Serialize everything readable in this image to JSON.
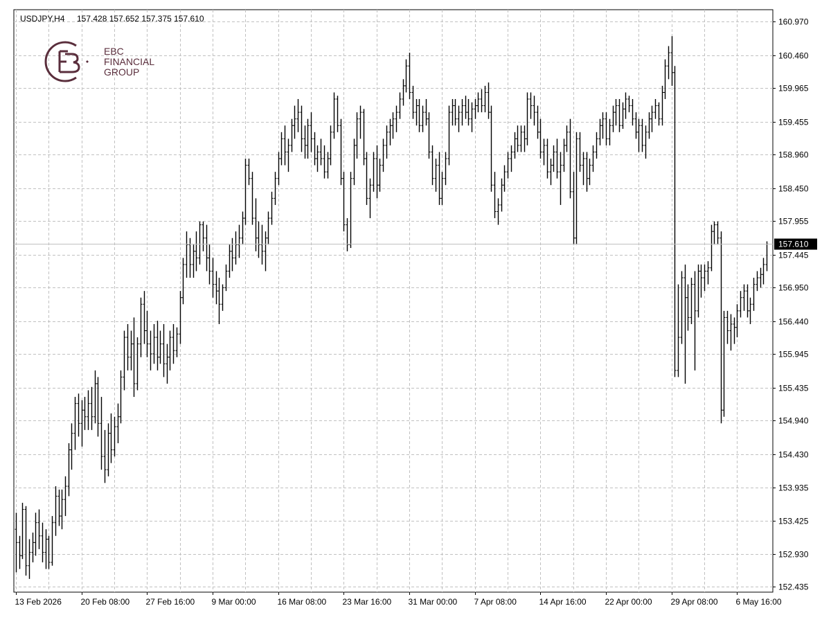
{
  "header": {
    "symbol": "USDJPY,H4",
    "ohlc": "157.428 157.652 157.375 157.610"
  },
  "logo": {
    "line1": "EBC",
    "line2": "FINANCIAL",
    "line3": "GROUP",
    "color": "#5a2e3c"
  },
  "colors": {
    "bars": "#000000",
    "grid": "#c0c0c0",
    "axis": "#000000",
    "current_price_line": "#c0c0c0",
    "current_price_label_bg": "#000000",
    "current_price_label_text": "#ffffff"
  },
  "chart_data": {
    "type": "ohlc",
    "timeframe": "H4",
    "y_ticks": [
      160.97,
      160.46,
      159.965,
      159.455,
      158.96,
      158.45,
      157.955,
      157.445,
      156.95,
      156.44,
      155.945,
      155.435,
      154.94,
      154.43,
      153.935,
      153.425,
      152.93,
      152.435
    ],
    "y_tick_labels": [
      "160.970",
      "160.460",
      "159.965",
      "159.455",
      "158.960",
      "158.450",
      "157.955",
      "157.445",
      "156.950",
      "156.440",
      "155.945",
      "155.435",
      "154.940",
      "154.430",
      "153.935",
      "153.425",
      "152.930",
      "152.435"
    ],
    "ylim": [
      152.35,
      161.15
    ],
    "x_tick_labels": [
      "13 Feb 2026",
      "20 Feb 08:00",
      "27 Feb 16:00",
      "9 Mar 00:00",
      "16 Mar 08:00",
      "23 Mar 16:00",
      "31 Mar 00:00",
      "7 Apr 08:00",
      "14 Apr 16:00",
      "22 Apr 00:00",
      "29 Apr 08:00",
      "6 May 16:00"
    ],
    "x_tick_bar_index": [
      0,
      20,
      40,
      60,
      80,
      100,
      120,
      140,
      160,
      180,
      200,
      220
    ],
    "current_price": 157.61,
    "current_price_label": "157.610",
    "grid": true,
    "bars": [
      [
        153.3,
        153.55,
        152.65,
        153.1
      ],
      [
        153.1,
        153.2,
        152.7,
        152.9
      ],
      [
        152.9,
        153.7,
        152.85,
        153.6
      ],
      [
        153.6,
        153.65,
        152.6,
        152.75
      ],
      [
        152.75,
        153.15,
        152.55,
        152.95
      ],
      [
        152.95,
        153.25,
        152.8,
        153.1
      ],
      [
        153.1,
        153.55,
        152.9,
        153.4
      ],
      [
        153.4,
        153.6,
        153.0,
        153.2
      ],
      [
        153.2,
        153.4,
        152.8,
        152.95
      ],
      [
        152.95,
        153.3,
        152.7,
        153.15
      ],
      [
        153.15,
        153.2,
        152.7,
        152.8
      ],
      [
        152.8,
        153.5,
        152.75,
        153.4
      ],
      [
        153.4,
        153.95,
        153.2,
        153.8
      ],
      [
        153.8,
        153.9,
        153.35,
        153.5
      ],
      [
        153.5,
        153.9,
        153.3,
        153.75
      ],
      [
        153.75,
        154.1,
        153.5,
        153.95
      ],
      [
        153.95,
        154.6,
        153.8,
        154.5
      ],
      [
        154.5,
        154.9,
        154.2,
        154.75
      ],
      [
        154.75,
        155.3,
        154.5,
        155.2
      ],
      [
        155.2,
        155.35,
        154.7,
        154.9
      ],
      [
        154.9,
        155.25,
        154.55,
        155.1
      ],
      [
        155.1,
        155.3,
        154.8,
        155.0
      ],
      [
        155.0,
        155.4,
        154.8,
        155.2
      ],
      [
        155.2,
        155.45,
        154.8,
        155.0
      ],
      [
        155.0,
        155.7,
        154.9,
        155.5
      ],
      [
        155.5,
        155.6,
        154.7,
        154.9
      ],
      [
        154.9,
        155.3,
        154.2,
        154.4
      ],
      [
        154.4,
        154.8,
        154.0,
        154.2
      ],
      [
        154.2,
        154.9,
        154.1,
        154.75
      ],
      [
        154.75,
        155.05,
        154.3,
        154.5
      ],
      [
        154.5,
        155.0,
        154.4,
        154.85
      ],
      [
        154.85,
        155.2,
        154.6,
        155.0
      ],
      [
        155.0,
        155.7,
        154.9,
        155.6
      ],
      [
        155.6,
        156.3,
        155.4,
        156.2
      ],
      [
        156.2,
        156.4,
        155.7,
        155.9
      ],
      [
        155.9,
        156.3,
        155.7,
        156.1
      ],
      [
        156.1,
        156.5,
        155.3,
        155.5
      ],
      [
        155.5,
        156.2,
        155.4,
        156.1
      ],
      [
        156.1,
        156.8,
        155.9,
        156.7
      ],
      [
        156.7,
        156.9,
        156.1,
        156.3
      ],
      [
        156.3,
        156.6,
        155.9,
        156.1
      ],
      [
        156.1,
        156.3,
        155.7,
        155.95
      ],
      [
        155.95,
        156.4,
        155.8,
        156.2
      ],
      [
        156.2,
        156.45,
        155.7,
        155.9
      ],
      [
        155.9,
        156.3,
        155.8,
        156.1
      ],
      [
        156.1,
        156.4,
        155.6,
        155.8
      ],
      [
        155.8,
        156.1,
        155.5,
        155.9
      ],
      [
        155.9,
        156.3,
        155.7,
        156.2
      ],
      [
        156.2,
        156.4,
        155.8,
        156.0
      ],
      [
        156.0,
        156.35,
        155.9,
        156.25
      ],
      [
        156.25,
        156.9,
        156.1,
        156.8
      ],
      [
        156.8,
        157.4,
        156.7,
        157.3
      ],
      [
        157.3,
        157.8,
        157.1,
        157.6
      ],
      [
        157.6,
        157.7,
        157.1,
        157.3
      ],
      [
        157.3,
        157.6,
        157.1,
        157.5
      ],
      [
        157.5,
        157.8,
        157.2,
        157.4
      ],
      [
        157.4,
        157.95,
        157.3,
        157.9
      ],
      [
        157.9,
        157.95,
        157.5,
        157.7
      ],
      [
        157.7,
        157.9,
        157.2,
        157.4
      ],
      [
        157.4,
        157.6,
        157.0,
        157.2
      ],
      [
        157.2,
        157.4,
        156.8,
        157.0
      ],
      [
        157.0,
        157.2,
        156.7,
        156.9
      ],
      [
        156.9,
        157.1,
        156.4,
        156.7
      ],
      [
        156.7,
        157.0,
        156.6,
        156.95
      ],
      [
        156.95,
        157.3,
        156.9,
        157.2
      ],
      [
        157.2,
        157.6,
        157.1,
        157.5
      ],
      [
        157.5,
        157.7,
        157.2,
        157.4
      ],
      [
        157.4,
        157.8,
        157.3,
        157.6
      ],
      [
        157.6,
        157.9,
        157.4,
        157.7
      ],
      [
        157.7,
        158.1,
        157.6,
        158.0
      ],
      [
        158.0,
        158.9,
        157.9,
        158.8
      ],
      [
        158.8,
        158.9,
        158.5,
        158.6
      ],
      [
        158.6,
        158.7,
        157.9,
        158.0
      ],
      [
        158.0,
        158.3,
        157.5,
        157.7
      ],
      [
        157.7,
        157.95,
        157.4,
        157.6
      ],
      [
        157.6,
        157.9,
        157.3,
        157.5
      ],
      [
        157.5,
        157.8,
        157.2,
        157.7
      ],
      [
        157.7,
        158.1,
        157.6,
        158.0
      ],
      [
        158.0,
        158.4,
        157.9,
        158.3
      ],
      [
        158.3,
        158.7,
        158.2,
        158.6
      ],
      [
        158.6,
        159.0,
        158.5,
        158.9
      ],
      [
        158.9,
        159.3,
        158.8,
        159.2
      ],
      [
        159.2,
        159.4,
        158.8,
        159.0
      ],
      [
        159.0,
        159.2,
        158.7,
        159.1
      ],
      [
        159.1,
        159.5,
        159.0,
        159.4
      ],
      [
        159.4,
        159.7,
        159.2,
        159.5
      ],
      [
        159.5,
        159.8,
        159.3,
        159.6
      ],
      [
        159.6,
        159.7,
        159.0,
        159.2
      ],
      [
        159.2,
        159.4,
        158.9,
        159.1
      ],
      [
        159.1,
        159.5,
        158.9,
        159.4
      ],
      [
        159.4,
        159.6,
        159.0,
        159.2
      ],
      [
        159.2,
        159.3,
        158.8,
        158.9
      ],
      [
        158.9,
        159.1,
        158.7,
        159.0
      ],
      [
        159.0,
        159.2,
        158.8,
        158.9
      ],
      [
        158.9,
        159.1,
        158.6,
        158.7
      ],
      [
        158.7,
        159.0,
        158.6,
        158.9
      ],
      [
        158.9,
        159.4,
        158.8,
        159.3
      ],
      [
        159.3,
        159.9,
        159.2,
        159.8
      ],
      [
        159.8,
        159.85,
        159.3,
        159.4
      ],
      [
        159.4,
        159.5,
        158.5,
        158.6
      ],
      [
        158.6,
        158.7,
        157.8,
        157.9
      ],
      [
        157.9,
        158.0,
        157.5,
        157.6
      ],
      [
        157.6,
        158.7,
        157.55,
        158.6
      ],
      [
        158.6,
        159.2,
        158.5,
        159.1
      ],
      [
        159.1,
        159.6,
        158.9,
        159.5
      ],
      [
        159.5,
        159.7,
        159.2,
        159.6
      ],
      [
        159.6,
        159.65,
        158.8,
        158.9
      ],
      [
        158.9,
        159.0,
        158.2,
        158.3
      ],
      [
        158.3,
        158.6,
        158.0,
        158.5
      ],
      [
        158.5,
        159.0,
        158.4,
        158.9
      ],
      [
        158.9,
        159.1,
        158.3,
        158.5
      ],
      [
        158.5,
        158.9,
        158.4,
        158.8
      ],
      [
        158.8,
        159.2,
        158.7,
        159.1
      ],
      [
        159.1,
        159.4,
        158.9,
        159.3
      ],
      [
        159.3,
        159.5,
        159.1,
        159.4
      ],
      [
        159.4,
        159.6,
        159.2,
        159.5
      ],
      [
        159.5,
        159.7,
        159.3,
        159.6
      ],
      [
        159.6,
        159.9,
        159.5,
        159.8
      ],
      [
        159.8,
        160.1,
        159.7,
        160.0
      ],
      [
        160.0,
        160.4,
        159.9,
        160.3
      ],
      [
        160.3,
        160.5,
        159.8,
        159.9
      ],
      [
        159.9,
        160.0,
        159.5,
        159.6
      ],
      [
        159.6,
        159.8,
        159.4,
        159.7
      ],
      [
        159.7,
        159.8,
        159.3,
        159.4
      ],
      [
        159.4,
        159.7,
        159.3,
        159.6
      ],
      [
        159.6,
        159.8,
        159.4,
        159.5
      ],
      [
        159.5,
        159.6,
        158.9,
        159.0
      ],
      [
        159.0,
        159.1,
        158.5,
        158.6
      ],
      [
        158.6,
        158.9,
        158.4,
        158.8
      ],
      [
        158.8,
        159.0,
        158.2,
        158.3
      ],
      [
        158.3,
        158.7,
        158.2,
        158.6
      ],
      [
        158.6,
        159.0,
        158.5,
        158.9
      ],
      [
        158.9,
        159.7,
        158.8,
        159.6
      ],
      [
        159.6,
        159.8,
        159.4,
        159.7
      ],
      [
        159.7,
        159.8,
        159.4,
        159.5
      ],
      [
        159.5,
        159.7,
        159.3,
        159.6
      ],
      [
        159.6,
        159.8,
        159.4,
        159.7
      ],
      [
        159.7,
        159.85,
        159.5,
        159.6
      ],
      [
        159.6,
        159.8,
        159.4,
        159.5
      ],
      [
        159.5,
        159.75,
        159.3,
        159.65
      ],
      [
        159.65,
        159.8,
        159.5,
        159.7
      ],
      [
        159.7,
        159.9,
        159.6,
        159.8
      ],
      [
        159.8,
        159.95,
        159.6,
        159.7
      ],
      [
        159.7,
        160.0,
        159.6,
        159.9
      ],
      [
        159.9,
        160.05,
        159.5,
        159.6
      ]
    ],
    "bars_part2": [
      [
        159.6,
        159.7,
        158.4,
        158.5
      ],
      [
        158.5,
        158.7,
        158.0,
        158.1
      ],
      [
        158.1,
        158.3,
        157.9,
        158.2
      ],
      [
        158.2,
        158.6,
        158.1,
        158.5
      ],
      [
        158.5,
        158.8,
        158.4,
        158.7
      ],
      [
        158.7,
        159.0,
        158.6,
        158.9
      ],
      [
        158.9,
        159.1,
        158.7,
        159.0
      ],
      [
        159.0,
        159.3,
        158.9,
        159.2
      ],
      [
        159.2,
        159.4,
        159.0,
        159.1
      ],
      [
        159.1,
        159.4,
        159.0,
        159.3
      ],
      [
        159.3,
        159.4,
        159.0,
        159.2
      ],
      [
        159.2,
        159.9,
        159.1,
        159.8
      ],
      [
        159.8,
        159.9,
        159.5,
        159.7
      ],
      [
        159.7,
        159.85,
        159.4,
        159.6
      ],
      [
        159.6,
        159.7,
        159.2,
        159.3
      ],
      [
        159.3,
        159.5,
        158.9,
        159.0
      ],
      [
        159.0,
        159.2,
        158.8,
        159.1
      ],
      [
        159.1,
        159.2,
        158.6,
        158.7
      ],
      [
        158.7,
        158.9,
        158.5,
        158.8
      ],
      [
        158.8,
        159.1,
        158.7,
        159.0
      ],
      [
        159.0,
        159.2,
        158.6,
        158.7
      ],
      [
        158.7,
        159.0,
        158.2,
        158.8
      ],
      [
        158.8,
        159.2,
        158.7,
        159.1
      ],
      [
        159.1,
        159.4,
        159.0,
        159.3
      ],
      [
        159.3,
        159.5,
        158.3,
        158.4
      ],
      [
        158.4,
        158.7,
        157.6,
        157.7
      ],
      [
        157.7,
        159.3,
        157.6,
        159.2
      ],
      [
        159.2,
        159.3,
        158.7,
        158.8
      ],
      [
        158.8,
        159.0,
        158.5,
        158.9
      ],
      [
        158.9,
        159.0,
        158.4,
        158.6
      ],
      [
        158.6,
        158.9,
        158.5,
        158.8
      ],
      [
        158.8,
        159.1,
        158.7,
        159.0
      ],
      [
        159.0,
        159.3,
        158.9,
        159.2
      ],
      [
        159.2,
        159.5,
        159.1,
        159.4
      ],
      [
        159.4,
        159.6,
        159.2,
        159.5
      ],
      [
        159.5,
        159.6,
        159.1,
        159.2
      ],
      [
        159.2,
        159.5,
        159.1,
        159.4
      ],
      [
        159.4,
        159.7,
        159.3,
        159.6
      ],
      [
        159.6,
        159.8,
        159.4,
        159.7
      ],
      [
        159.7,
        159.8,
        159.3,
        159.4
      ],
      [
        159.4,
        159.75,
        159.35,
        159.65
      ],
      [
        159.65,
        159.9,
        159.5,
        159.8
      ],
      [
        159.8,
        159.85,
        159.6,
        159.7
      ],
      [
        159.7,
        159.8,
        159.4,
        159.5
      ],
      [
        159.5,
        159.6,
        159.2,
        159.3
      ],
      [
        159.3,
        159.5,
        159.0,
        159.4
      ],
      [
        159.4,
        159.5,
        159.0,
        159.1
      ],
      [
        159.1,
        159.4,
        158.9,
        159.3
      ],
      [
        159.3,
        159.6,
        159.2,
        159.5
      ],
      [
        159.5,
        159.7,
        159.3,
        159.6
      ],
      [
        159.6,
        159.8,
        159.5,
        159.7
      ],
      [
        159.7,
        159.75,
        159.4,
        159.5
      ],
      [
        159.5,
        160.0,
        159.4,
        159.9
      ],
      [
        159.9,
        160.4,
        159.8,
        160.3
      ],
      [
        160.3,
        160.6,
        160.1,
        160.5
      ],
      [
        160.5,
        160.75,
        160.0,
        160.2
      ],
      [
        160.2,
        160.3,
        155.6,
        155.7
      ],
      [
        155.7,
        157.0,
        155.6,
        156.2
      ],
      [
        156.2,
        157.2,
        156.1,
        157.1
      ],
      [
        157.1,
        157.3,
        155.5,
        156.8
      ],
      [
        156.8,
        157.0,
        156.3,
        156.5
      ],
      [
        156.5,
        157.1,
        156.4,
        157.0
      ],
      [
        157.0,
        157.2,
        155.7,
        156.6
      ],
      [
        156.6,
        157.3,
        156.5,
        157.2
      ],
      [
        157.2,
        157.3,
        156.8,
        157.1
      ],
      [
        157.1,
        157.3,
        156.9,
        157.2
      ],
      [
        157.2,
        157.35,
        157.0,
        157.25
      ],
      [
        157.25,
        157.9,
        157.2,
        157.8
      ],
      [
        157.8,
        157.95,
        157.6,
        157.9
      ],
      [
        157.9,
        157.95,
        157.6,
        157.7
      ],
      [
        157.7,
        157.8,
        154.9,
        155.1
      ],
      [
        155.1,
        156.6,
        155.0,
        156.5
      ],
      [
        156.5,
        156.6,
        156.1,
        156.3
      ],
      [
        156.3,
        156.55,
        156.0,
        156.4
      ],
      [
        156.4,
        156.5,
        156.1,
        156.35
      ],
      [
        156.35,
        156.7,
        156.2,
        156.6
      ],
      [
        156.6,
        156.9,
        156.5,
        156.8
      ],
      [
        156.8,
        157.0,
        156.6,
        156.9
      ],
      [
        156.9,
        157.0,
        156.5,
        156.6
      ],
      [
        156.6,
        156.8,
        156.4,
        156.7
      ],
      [
        156.7,
        157.1,
        156.6,
        157.0
      ],
      [
        157.0,
        157.2,
        156.9,
        157.1
      ],
      [
        157.1,
        157.25,
        156.95,
        157.15
      ],
      [
        157.15,
        157.4,
        157.0,
        157.3
      ],
      [
        157.3,
        157.65,
        157.2,
        157.61
      ]
    ]
  }
}
